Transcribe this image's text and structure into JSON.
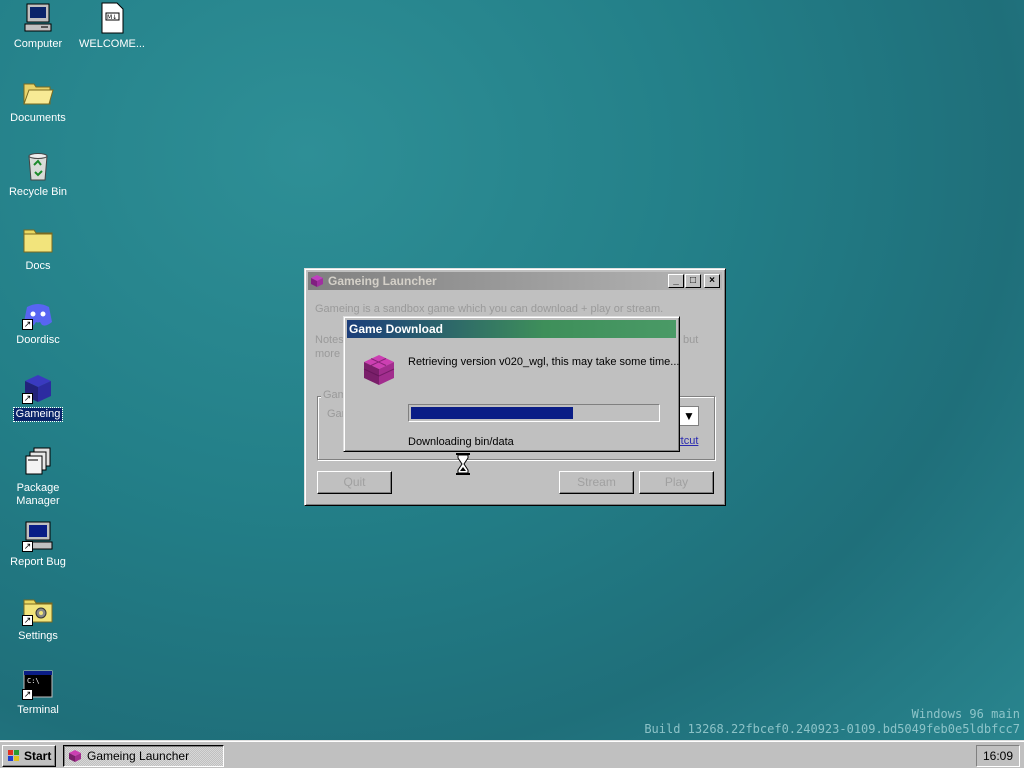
{
  "desktop": {
    "icons": [
      {
        "label": "Computer"
      },
      {
        "label": "WELCOME..."
      },
      {
        "label": "Documents"
      },
      {
        "label": "Recycle Bin"
      },
      {
        "label": "Docs"
      },
      {
        "label": "Doordisc"
      },
      {
        "label": "Gameing"
      },
      {
        "label": "Package\nManager"
      },
      {
        "label": "Report Bug"
      },
      {
        "label": "Settings"
      },
      {
        "label": "Terminal"
      }
    ],
    "watermark_line1": "Windows 96 main",
    "watermark_line2": "Build 13268.22fbcef0.240923-0109.bd5049feb0e5ldbfcc7"
  },
  "launcher": {
    "title": "Gameing Launcher",
    "intro": "Gameing is a sandbox game which you can download + play or stream.",
    "notes_left": "Notes",
    "notes_right": "but",
    "more_left": "more",
    "group_label": "Game",
    "game_label": "Gam",
    "shortcut_link": "rtcut",
    "quit_label": "Quit",
    "stream_label": "Stream",
    "play_label": "Play"
  },
  "download": {
    "title": "Game Download",
    "message": "Retrieving version v020_wgl, this may take some time...",
    "status": "Downloading bin/data",
    "progress": 0.66
  },
  "taskbar": {
    "start_label": "Start",
    "task_label": "Gameing Launcher",
    "clock": "16:09"
  },
  "colors": {
    "desktop": "#237f88",
    "progress": "#0a1d86",
    "selection": "#0a246a"
  }
}
